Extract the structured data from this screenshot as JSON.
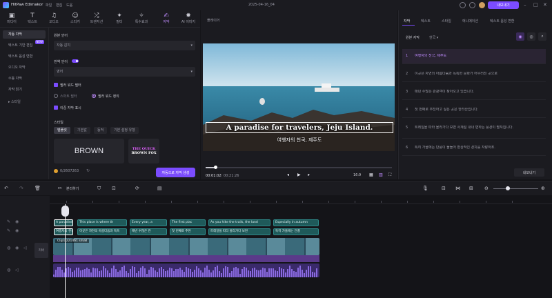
{
  "titlebar": {
    "app_name": "HitPaw Edimakor",
    "menus": [
      "파일",
      "편집",
      "도움"
    ],
    "project": "2025-04-16_04",
    "export_label": "내보내기"
  },
  "left_tabs": [
    {
      "label": "미디어",
      "icon": "▣"
    },
    {
      "label": "텍스트",
      "icon": "T"
    },
    {
      "label": "오디오",
      "icon": "♫"
    },
    {
      "label": "스티커",
      "icon": "☺"
    },
    {
      "label": "트랜지션",
      "icon": "⤮"
    },
    {
      "label": "필터",
      "icon": "✦"
    },
    {
      "label": "특수효과",
      "icon": "✧"
    },
    {
      "label": "자막",
      "icon": "✍"
    },
    {
      "label": "AI 이미지",
      "icon": "✹"
    }
  ],
  "left_nav": [
    "자동 자막",
    "텍스트 기반 편집",
    "텍스트 음성 변환",
    "오디오 자막",
    "수동 자막",
    "자막 읽기",
    "스타일"
  ],
  "new_badge": "NEW",
  "settings": {
    "src_lang_label": "원본 언어",
    "src_lang_value": "자동 감지",
    "translate_label": "번역 언어",
    "translate_value": "영어",
    "opt_filler": "필러 워드 필터",
    "radio_1": "스마트 필터",
    "radio_2": "필러 워드 정의",
    "opt_bilingual": "이중 자막 표시",
    "style_label": "스타일",
    "style_tabs": [
      "템플릿",
      "기본값",
      "동적",
      "기본 설정 유형"
    ],
    "preset_1": "BROWN",
    "preset_2_line1": "THE QUICK",
    "preset_2_line2": "BROWN FOX",
    "credits": "0/2607263",
    "autocap_btn": "자동으로 자막 생성"
  },
  "player": {
    "title": "플레이어",
    "caption_en": "A paradise for travelers, Jeju Island.",
    "caption_ko": "여행자의 천국, 제주도",
    "time_current": "00:01:02",
    "time_total": "00:21:26",
    "zoom": "16:9"
  },
  "right_panel": {
    "tabs": [
      "자막",
      "텍스트",
      "스타일",
      "애니메이션",
      "텍스트 음성 변환"
    ],
    "src_lang_label": "원본 자막",
    "src_lang_value": "한국",
    "captions": [
      {
        "n": "1",
        "text": "여행자의 천국, 제주도"
      },
      {
        "n": "2",
        "text": "이곳은 자연의 아름다움과 독특한 문화가 어우러진 곳으로"
      },
      {
        "n": "3",
        "text": "매년 수많은 관광객이 찾아오고 있습니다."
      },
      {
        "n": "4",
        "text": "첫 번째로 추천하고 싶은 곳은 한라산입니다."
      },
      {
        "n": "5",
        "text": "트레일을 따라 올라가다 보면 사계절 내내 변하는 풍경이 펼쳐집니다."
      },
      {
        "n": "6",
        "text": "특히 가을에는 단풍이 물들어 환상적인 경치를 자랑하죠."
      }
    ],
    "export_label": "내보내기"
  },
  "timeline": {
    "split_label": "분리하기",
    "ruler": [
      "00:00:00",
      "00:00:10",
      "00:00:20",
      "00:00:30",
      "00:00:40",
      "00:00:50",
      "00:01:00",
      "00:01:10",
      "00:01:20",
      "00:01:30",
      "00:01:40",
      "00:01:50",
      "00:02:00",
      "00:02:10",
      "00:02:20",
      "00:02:30",
      "00:02:40",
      "00:02:50"
    ],
    "cover_label": "커버",
    "video_clip_name": "Clip1 221461 small",
    "caption_clips_en": [
      "A paradise...",
      "This place is where th",
      "Every year, a",
      "The first plac",
      "As you hike the trails, the land",
      "Especially in autumn"
    ],
    "caption_clips_ko": [
      "여행자의 천국",
      "이곳은 자연의 아름다움과 독특",
      "매년 수많은 관",
      "첫 번째로 추천",
      "트레일을 따라 올라가다 보면",
      "특히 가을에는 단풍"
    ]
  }
}
